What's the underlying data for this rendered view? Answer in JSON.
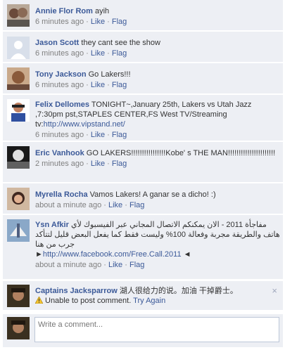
{
  "comments": [
    {
      "author": "Annie Flor Rom",
      "text": "ayih",
      "time": "6 minutes ago",
      "like": "Like",
      "flag": "Flag",
      "sep": "·"
    },
    {
      "author": "Jason Scott",
      "text": "they cant see the show",
      "time": "6 minutes ago",
      "like": "Like",
      "flag": "Flag",
      "sep": "·"
    },
    {
      "author": "Tony Jackson",
      "text": "Go Lakers!!!",
      "time": "6 minutes ago",
      "like": "Like",
      "flag": "Flag",
      "sep": "·"
    },
    {
      "author": "Felix Dellomes",
      "text": "TONIGHT~,January 25th, Lakers vs Utah Jazz ,7:30pm pst,STAPLES CENTER,FS West TV/Streaming tv:",
      "link": "http://www.vipstand.net/",
      "time": "6 minutes ago",
      "like": "Like",
      "flag": "Flag",
      "sep": "·"
    },
    {
      "author": "Eric Vanhook",
      "text": "GO LAKERS!!!!!!!!!!!!!!!!Kobe' s THE MAN!!!!!!!!!!!!!!!!!!!!!!",
      "time": "2 minutes ago",
      "like": "Like",
      "flag": "Flag",
      "sep": "·"
    },
    {
      "author": "Myrella Rocha",
      "text": "Vamos Lakers! A ganar se a dicho! :)",
      "time": "about a minute ago",
      "like": "Like",
      "flag": "Flag",
      "sep": "·"
    },
    {
      "author": "Ysn Afkir",
      "text": "مفاجأة 2011 - الان يمكنكم الاتصال المجاني عبر الفيسبوك لأي هاتف والطريقة مجربة وفعالة 100% وليست فقط كما يفعل البعض قليل لتتأكد جرب من هنا",
      "link_prefix": "►",
      "link": "http://www.facebook.com/Free.Call.2011",
      "link_suffix": "◄",
      "time": "about a minute ago",
      "like": "Like",
      "flag": "Flag",
      "sep": "·"
    }
  ],
  "pending": {
    "author": "Captains Jacksparrow",
    "text": "湖人很给力的说。加油 干掉爵士。",
    "error": "Unable to post comment.",
    "retry": "Try Again",
    "close": "×"
  },
  "composer": {
    "placeholder": "Write a comment..."
  },
  "colors": {
    "link": "#3b5998",
    "background": "#edeff4",
    "meta": "#808080",
    "border": "#bdc7d8"
  }
}
